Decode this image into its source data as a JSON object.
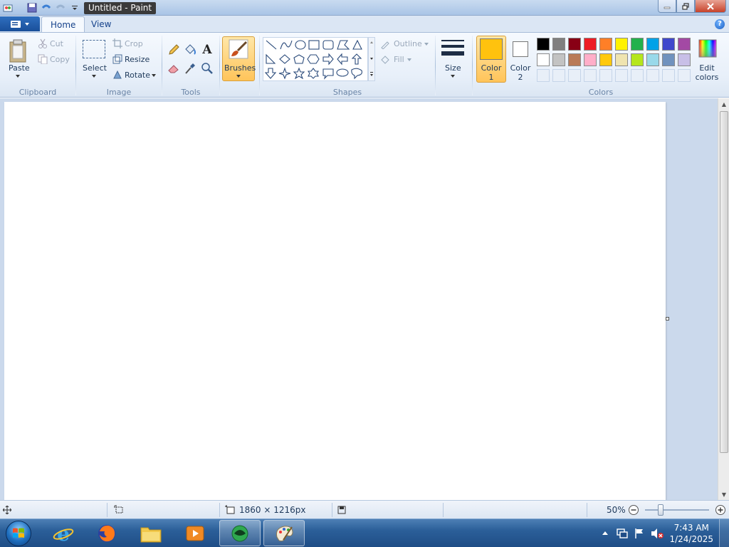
{
  "window": {
    "title": "Untitled - Paint",
    "controls": {
      "minimize": "minimize",
      "maximize": "restore",
      "close": "close"
    }
  },
  "tabs": [
    {
      "label": "Home",
      "active": true
    },
    {
      "label": "View",
      "active": false
    }
  ],
  "ribbon": {
    "clipboard": {
      "label": "Clipboard",
      "paste": "Paste",
      "cut": "Cut",
      "copy": "Copy"
    },
    "image": {
      "label": "Image",
      "select": "Select",
      "crop": "Crop",
      "resize": "Resize",
      "rotate": "Rotate"
    },
    "tools": {
      "label": "Tools"
    },
    "brushes": {
      "label": "Brushes"
    },
    "shapes": {
      "label": "Shapes",
      "outline": "Outline",
      "fill": "Fill"
    },
    "size": {
      "label": "Size"
    },
    "colors": {
      "label": "Colors",
      "color1_label": "Color\n1",
      "color2_label": "Color\n2",
      "color1": "#ffc20e",
      "color2": "#ffffff",
      "edit_colors": "Edit\ncolors",
      "palette_row1": [
        "#000000",
        "#7f7f7f",
        "#880015",
        "#ed1c24",
        "#ff7f27",
        "#fff200",
        "#22b14c",
        "#00a2e8",
        "#3f48cc",
        "#a349a4"
      ],
      "palette_row2": [
        "#ffffff",
        "#c3c3c3",
        "#b97a57",
        "#ffaec9",
        "#ffc90e",
        "#efe4b0",
        "#b5e61d",
        "#99d9ea",
        "#7092be",
        "#c8bfe7"
      ]
    }
  },
  "statusbar": {
    "dimensions": "1860 × 1216px",
    "zoom": "50%"
  },
  "taskbar": {
    "time": "7:43 AM",
    "date": "1/24/2025"
  }
}
